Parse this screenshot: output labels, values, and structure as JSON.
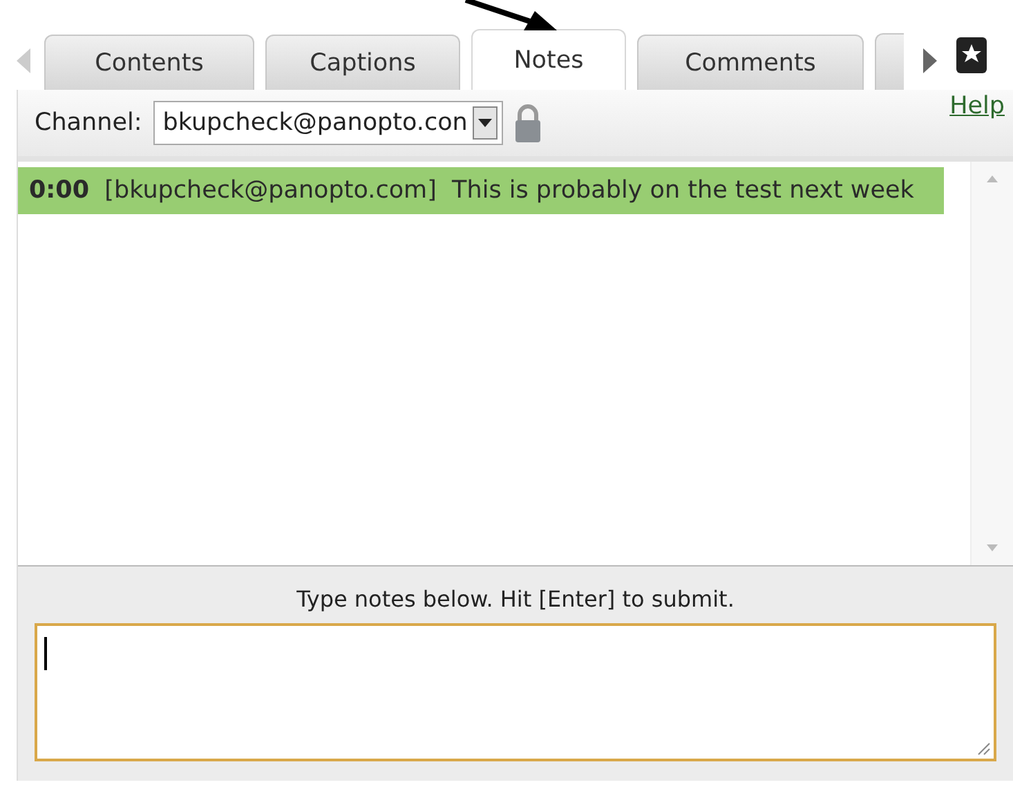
{
  "tabs": [
    {
      "label": "Contents",
      "selected": false
    },
    {
      "label": "Captions",
      "selected": false
    },
    {
      "label": "Notes",
      "selected": true
    },
    {
      "label": "Comments",
      "selected": false
    }
  ],
  "channel": {
    "label": "Channel:",
    "value": "bkupcheck@panopto.con",
    "locked": true
  },
  "help_link": "Help",
  "notes": [
    {
      "time": "0:00",
      "author": "[bkupcheck@panopto.com]",
      "text": "This is probably on the test next week",
      "selected": true
    }
  ],
  "instruction": "Type notes below. Hit [Enter] to submit."
}
